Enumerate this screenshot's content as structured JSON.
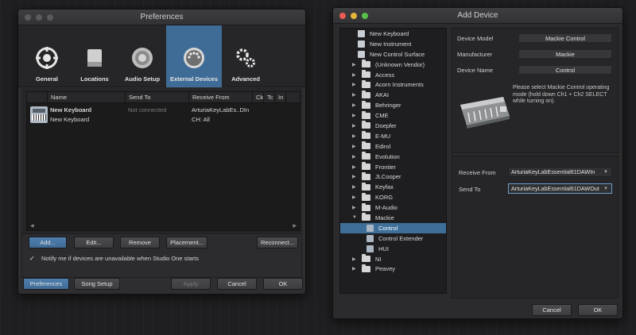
{
  "preferences": {
    "title": "Preferences",
    "toolbar": [
      {
        "label": "General",
        "icon": "gear-circle-icon"
      },
      {
        "label": "Locations",
        "icon": "drive-icon"
      },
      {
        "label": "Audio Setup",
        "icon": "speaker-icon"
      },
      {
        "label": "External Devices",
        "icon": "midi-port-icon",
        "active": true
      },
      {
        "label": "Advanced",
        "icon": "gears-icon"
      }
    ],
    "table": {
      "headers": [
        "Name",
        "Send To",
        "Receive From",
        "Ck",
        "Tc",
        "In"
      ],
      "row": {
        "name": "New Keyboard",
        "type": "New Keyboard",
        "send_to": "Not connected",
        "receive_from": "ArturiaKeyLabEs..DIn",
        "channel": "CH: All"
      }
    },
    "buttons": {
      "add": "Add...",
      "edit": "Edit...",
      "remove": "Remove",
      "placement": "Placement...",
      "reconnect": "Reconnect..."
    },
    "notify": "Notify me if devices are unavailable when Studio One starts",
    "footer": {
      "preferences": "Preferences",
      "song_setup": "Song Setup",
      "apply": "Apply",
      "cancel": "Cancel",
      "ok": "OK"
    }
  },
  "add_device": {
    "title": "Add Device",
    "tree": {
      "top": [
        "New Keyboard",
        "New Instrument",
        "New Control Surface"
      ],
      "vendors_a": [
        "(Unknown Vendor)",
        "Access",
        "Acorn Instruments",
        "AKAI",
        "Behringer",
        "CME",
        "Doepfer",
        "E-MU",
        "Edirol",
        "Evolution",
        "Frontier",
        "JLCooper",
        "Keyfax",
        "KORG",
        "M-Audio"
      ],
      "open": "Mackie",
      "children": [
        "Control",
        "Control Extender",
        "HUI"
      ],
      "selected_child": "Control",
      "vendors_b": [
        "NI",
        "Peavey"
      ]
    },
    "info": {
      "model_label": "Device Model",
      "model": "Mackie Control",
      "manufacturer_label": "Manufacturer",
      "manufacturer": "Mackie",
      "name_label": "Device Name",
      "name": "Control",
      "hint": "Please select Mackie Control operating mode (hold down Ch1 + Ch2 SELECT while turning on)."
    },
    "ports": {
      "receive_label": "Receive From",
      "receive": "ArturiaKeyLabEssential61DAWIn",
      "send_label": "Send To",
      "send": "ArturiaKeyLabEssential61DAWOut"
    },
    "footer": {
      "cancel": "Cancel",
      "ok": "OK"
    }
  }
}
